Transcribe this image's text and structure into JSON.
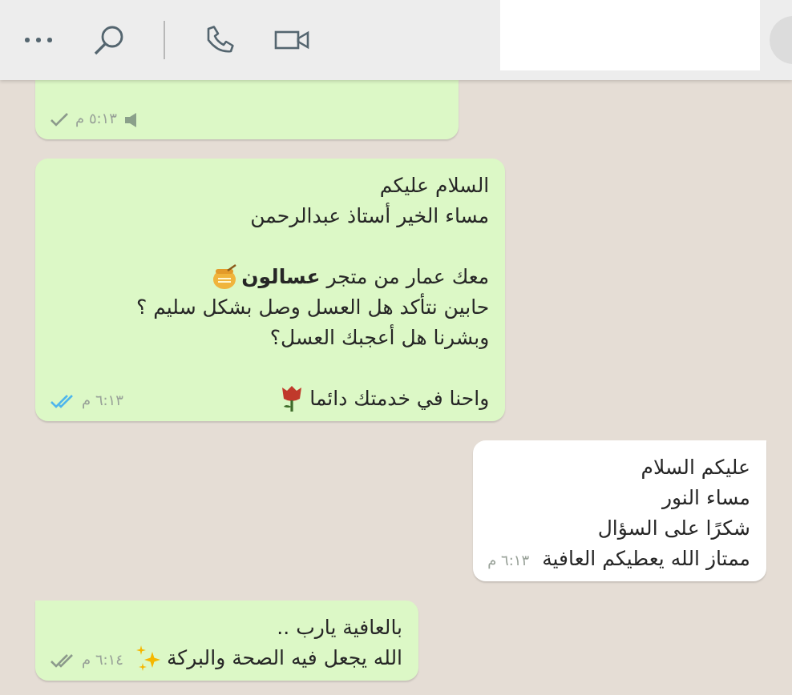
{
  "messages": [
    {
      "kind": "outgoing",
      "time": "٥:١٣ م",
      "delivered": false,
      "read": false
    },
    {
      "kind": "outgoing",
      "paragraphs": [
        [
          "السلام عليكم",
          "مساء الخير أستاذ عبدالرحمن"
        ],
        [
          "معك عمار من متجر **عسالون**",
          "حابين نتأكد هل العسل وصل بشكل سليم ؟",
          "وبشرنا هل أعجبك العسل؟"
        ],
        [
          "واحنا في خدمتك دائما"
        ]
      ],
      "time": "٦:١٣ م",
      "delivered": true,
      "read": true
    },
    {
      "kind": "incoming",
      "paragraphs": [
        [
          "عليكم السلام",
          "مساء النور",
          "شكرًا على السؤال",
          "ممتاز الله يعطيكم العافية"
        ]
      ],
      "time": "٦:١٣ م"
    },
    {
      "kind": "outgoing",
      "paragraphs": [
        [
          "بالعافية يارب ..",
          "الله يجعل فيه الصحة والبركة"
        ]
      ],
      "time": "٦:١٤ م",
      "delivered": true,
      "read": false
    }
  ]
}
